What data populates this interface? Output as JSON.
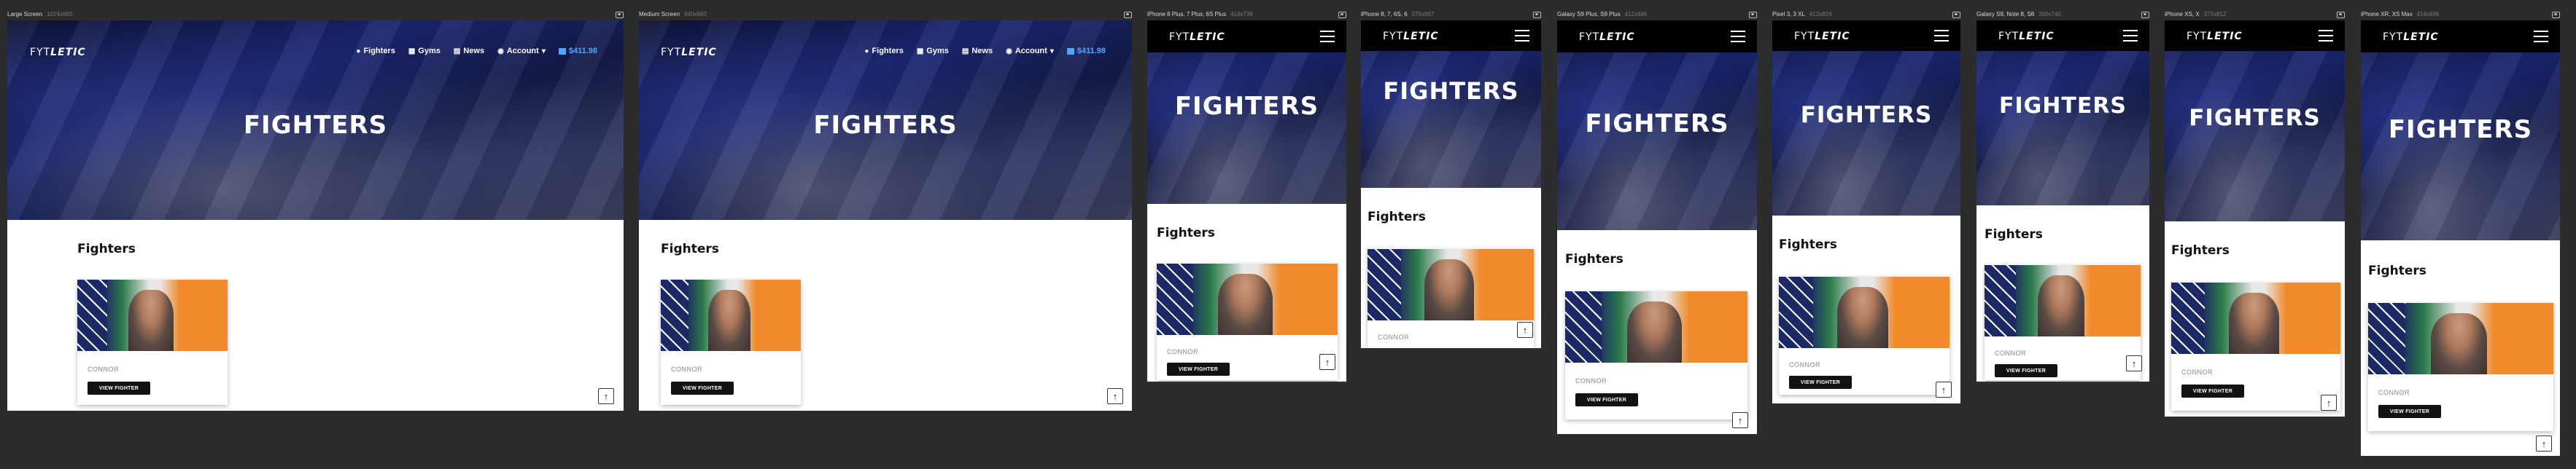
{
  "brand": {
    "logo_light": "FYT",
    "logo_bold": "LETIC"
  },
  "nav": {
    "fighters": "Fighters",
    "gyms": "Gyms",
    "news": "News",
    "account": "Account",
    "cart": "$411.98"
  },
  "hero": {
    "title": "FIGHTERS"
  },
  "section": {
    "title": "Fighters"
  },
  "card": {
    "name": "CONNOR",
    "button": "VIEW FIGHTER"
  },
  "icons": {
    "up": "arrow-up-icon",
    "menu": "hamburger-menu-icon",
    "frame": "image-icon"
  },
  "colors": {
    "accent": "#4aa8ff",
    "dark": "#111111",
    "nav_bg": "#000000"
  },
  "frames": [
    {
      "label": "Large Screen",
      "dim": "1024x683"
    },
    {
      "label": "Medium Screen",
      "dim": "840x683"
    },
    {
      "label": "iPhone 8 Plus, 7 Plus, 6S Plus",
      "dim": "414x736"
    },
    {
      "label": "iPhone 8, 7, 6S, 6",
      "dim": "375x667"
    },
    {
      "label": "Galaxy S9 Plus, S9 Plus",
      "dim": "412x846"
    },
    {
      "label": "Pixel 3, 3 XL",
      "dim": "412x824"
    },
    {
      "label": "Galaxy S9, Note 8, S8",
      "dim": "360x740"
    },
    {
      "label": "iPhone XS, X",
      "dim": "375x812"
    },
    {
      "label": "iPhone XR, XS Max",
      "dim": "414x896"
    }
  ]
}
